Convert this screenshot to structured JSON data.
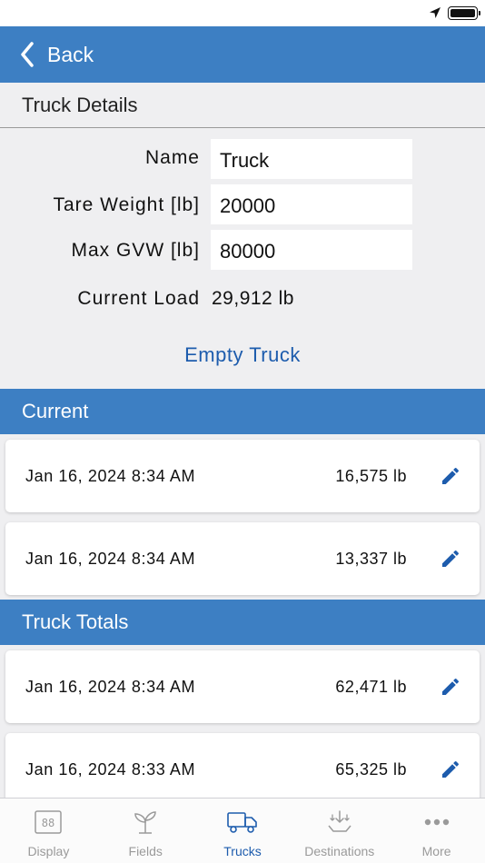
{
  "nav": {
    "back_label": "Back"
  },
  "truck_details": {
    "section_title": "Truck Details",
    "fields": [
      {
        "label": "Name",
        "value": "Truck"
      },
      {
        "label": "Tare Weight [lb]",
        "value": "20000"
      },
      {
        "label": "Max GVW [lb]",
        "value": "80000"
      }
    ],
    "current_load_label": "Current Load",
    "current_load_value": "29,912 lb",
    "empty_button_label": "Empty Truck"
  },
  "current": {
    "title": "Current",
    "entries": [
      {
        "date": "Jan 16, 2024 8:34 AM",
        "weight": "16,575 lb"
      },
      {
        "date": "Jan 16, 2024 8:34 AM",
        "weight": "13,337 lb"
      }
    ]
  },
  "truck_totals": {
    "title": "Truck Totals",
    "entries": [
      {
        "date": "Jan 16, 2024 8:34 AM",
        "weight": "62,471 lb"
      },
      {
        "date": "Jan 16, 2024 8:33 AM",
        "weight": "65,325 lb"
      }
    ]
  },
  "tab_bar": {
    "active": "Trucks",
    "tabs": [
      {
        "label": "Display",
        "icon": "display-icon"
      },
      {
        "label": "Fields",
        "icon": "sprout-icon"
      },
      {
        "label": "Trucks",
        "icon": "truck-icon"
      },
      {
        "label": "Destinations",
        "icon": "unload-icon"
      },
      {
        "label": "More",
        "icon": "more-dots-icon"
      }
    ]
  },
  "colors": {
    "accent": "#3d7fc3",
    "link": "#1d5cad",
    "background": "#efeff1",
    "inactive_tab": "#9a9a9a"
  }
}
